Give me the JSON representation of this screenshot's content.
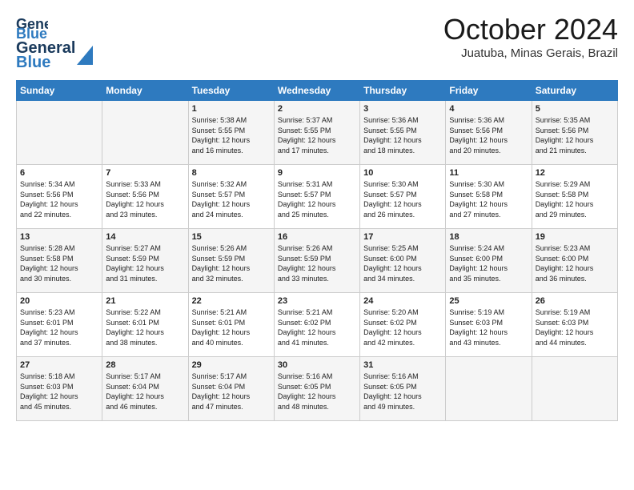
{
  "header": {
    "logo_line1": "General",
    "logo_line2": "Blue",
    "month": "October 2024",
    "location": "Juatuba, Minas Gerais, Brazil"
  },
  "days_of_week": [
    "Sunday",
    "Monday",
    "Tuesday",
    "Wednesday",
    "Thursday",
    "Friday",
    "Saturday"
  ],
  "weeks": [
    [
      {
        "day": "",
        "info": ""
      },
      {
        "day": "",
        "info": ""
      },
      {
        "day": "1",
        "info": "Sunrise: 5:38 AM\nSunset: 5:55 PM\nDaylight: 12 hours\nand 16 minutes."
      },
      {
        "day": "2",
        "info": "Sunrise: 5:37 AM\nSunset: 5:55 PM\nDaylight: 12 hours\nand 17 minutes."
      },
      {
        "day": "3",
        "info": "Sunrise: 5:36 AM\nSunset: 5:55 PM\nDaylight: 12 hours\nand 18 minutes."
      },
      {
        "day": "4",
        "info": "Sunrise: 5:36 AM\nSunset: 5:56 PM\nDaylight: 12 hours\nand 20 minutes."
      },
      {
        "day": "5",
        "info": "Sunrise: 5:35 AM\nSunset: 5:56 PM\nDaylight: 12 hours\nand 21 minutes."
      }
    ],
    [
      {
        "day": "6",
        "info": "Sunrise: 5:34 AM\nSunset: 5:56 PM\nDaylight: 12 hours\nand 22 minutes."
      },
      {
        "day": "7",
        "info": "Sunrise: 5:33 AM\nSunset: 5:56 PM\nDaylight: 12 hours\nand 23 minutes."
      },
      {
        "day": "8",
        "info": "Sunrise: 5:32 AM\nSunset: 5:57 PM\nDaylight: 12 hours\nand 24 minutes."
      },
      {
        "day": "9",
        "info": "Sunrise: 5:31 AM\nSunset: 5:57 PM\nDaylight: 12 hours\nand 25 minutes."
      },
      {
        "day": "10",
        "info": "Sunrise: 5:30 AM\nSunset: 5:57 PM\nDaylight: 12 hours\nand 26 minutes."
      },
      {
        "day": "11",
        "info": "Sunrise: 5:30 AM\nSunset: 5:58 PM\nDaylight: 12 hours\nand 27 minutes."
      },
      {
        "day": "12",
        "info": "Sunrise: 5:29 AM\nSunset: 5:58 PM\nDaylight: 12 hours\nand 29 minutes."
      }
    ],
    [
      {
        "day": "13",
        "info": "Sunrise: 5:28 AM\nSunset: 5:58 PM\nDaylight: 12 hours\nand 30 minutes."
      },
      {
        "day": "14",
        "info": "Sunrise: 5:27 AM\nSunset: 5:59 PM\nDaylight: 12 hours\nand 31 minutes."
      },
      {
        "day": "15",
        "info": "Sunrise: 5:26 AM\nSunset: 5:59 PM\nDaylight: 12 hours\nand 32 minutes."
      },
      {
        "day": "16",
        "info": "Sunrise: 5:26 AM\nSunset: 5:59 PM\nDaylight: 12 hours\nand 33 minutes."
      },
      {
        "day": "17",
        "info": "Sunrise: 5:25 AM\nSunset: 6:00 PM\nDaylight: 12 hours\nand 34 minutes."
      },
      {
        "day": "18",
        "info": "Sunrise: 5:24 AM\nSunset: 6:00 PM\nDaylight: 12 hours\nand 35 minutes."
      },
      {
        "day": "19",
        "info": "Sunrise: 5:23 AM\nSunset: 6:00 PM\nDaylight: 12 hours\nand 36 minutes."
      }
    ],
    [
      {
        "day": "20",
        "info": "Sunrise: 5:23 AM\nSunset: 6:01 PM\nDaylight: 12 hours\nand 37 minutes."
      },
      {
        "day": "21",
        "info": "Sunrise: 5:22 AM\nSunset: 6:01 PM\nDaylight: 12 hours\nand 38 minutes."
      },
      {
        "day": "22",
        "info": "Sunrise: 5:21 AM\nSunset: 6:01 PM\nDaylight: 12 hours\nand 40 minutes."
      },
      {
        "day": "23",
        "info": "Sunrise: 5:21 AM\nSunset: 6:02 PM\nDaylight: 12 hours\nand 41 minutes."
      },
      {
        "day": "24",
        "info": "Sunrise: 5:20 AM\nSunset: 6:02 PM\nDaylight: 12 hours\nand 42 minutes."
      },
      {
        "day": "25",
        "info": "Sunrise: 5:19 AM\nSunset: 6:03 PM\nDaylight: 12 hours\nand 43 minutes."
      },
      {
        "day": "26",
        "info": "Sunrise: 5:19 AM\nSunset: 6:03 PM\nDaylight: 12 hours\nand 44 minutes."
      }
    ],
    [
      {
        "day": "27",
        "info": "Sunrise: 5:18 AM\nSunset: 6:03 PM\nDaylight: 12 hours\nand 45 minutes."
      },
      {
        "day": "28",
        "info": "Sunrise: 5:17 AM\nSunset: 6:04 PM\nDaylight: 12 hours\nand 46 minutes."
      },
      {
        "day": "29",
        "info": "Sunrise: 5:17 AM\nSunset: 6:04 PM\nDaylight: 12 hours\nand 47 minutes."
      },
      {
        "day": "30",
        "info": "Sunrise: 5:16 AM\nSunset: 6:05 PM\nDaylight: 12 hours\nand 48 minutes."
      },
      {
        "day": "31",
        "info": "Sunrise: 5:16 AM\nSunset: 6:05 PM\nDaylight: 12 hours\nand 49 minutes."
      },
      {
        "day": "",
        "info": ""
      },
      {
        "day": "",
        "info": ""
      }
    ]
  ]
}
